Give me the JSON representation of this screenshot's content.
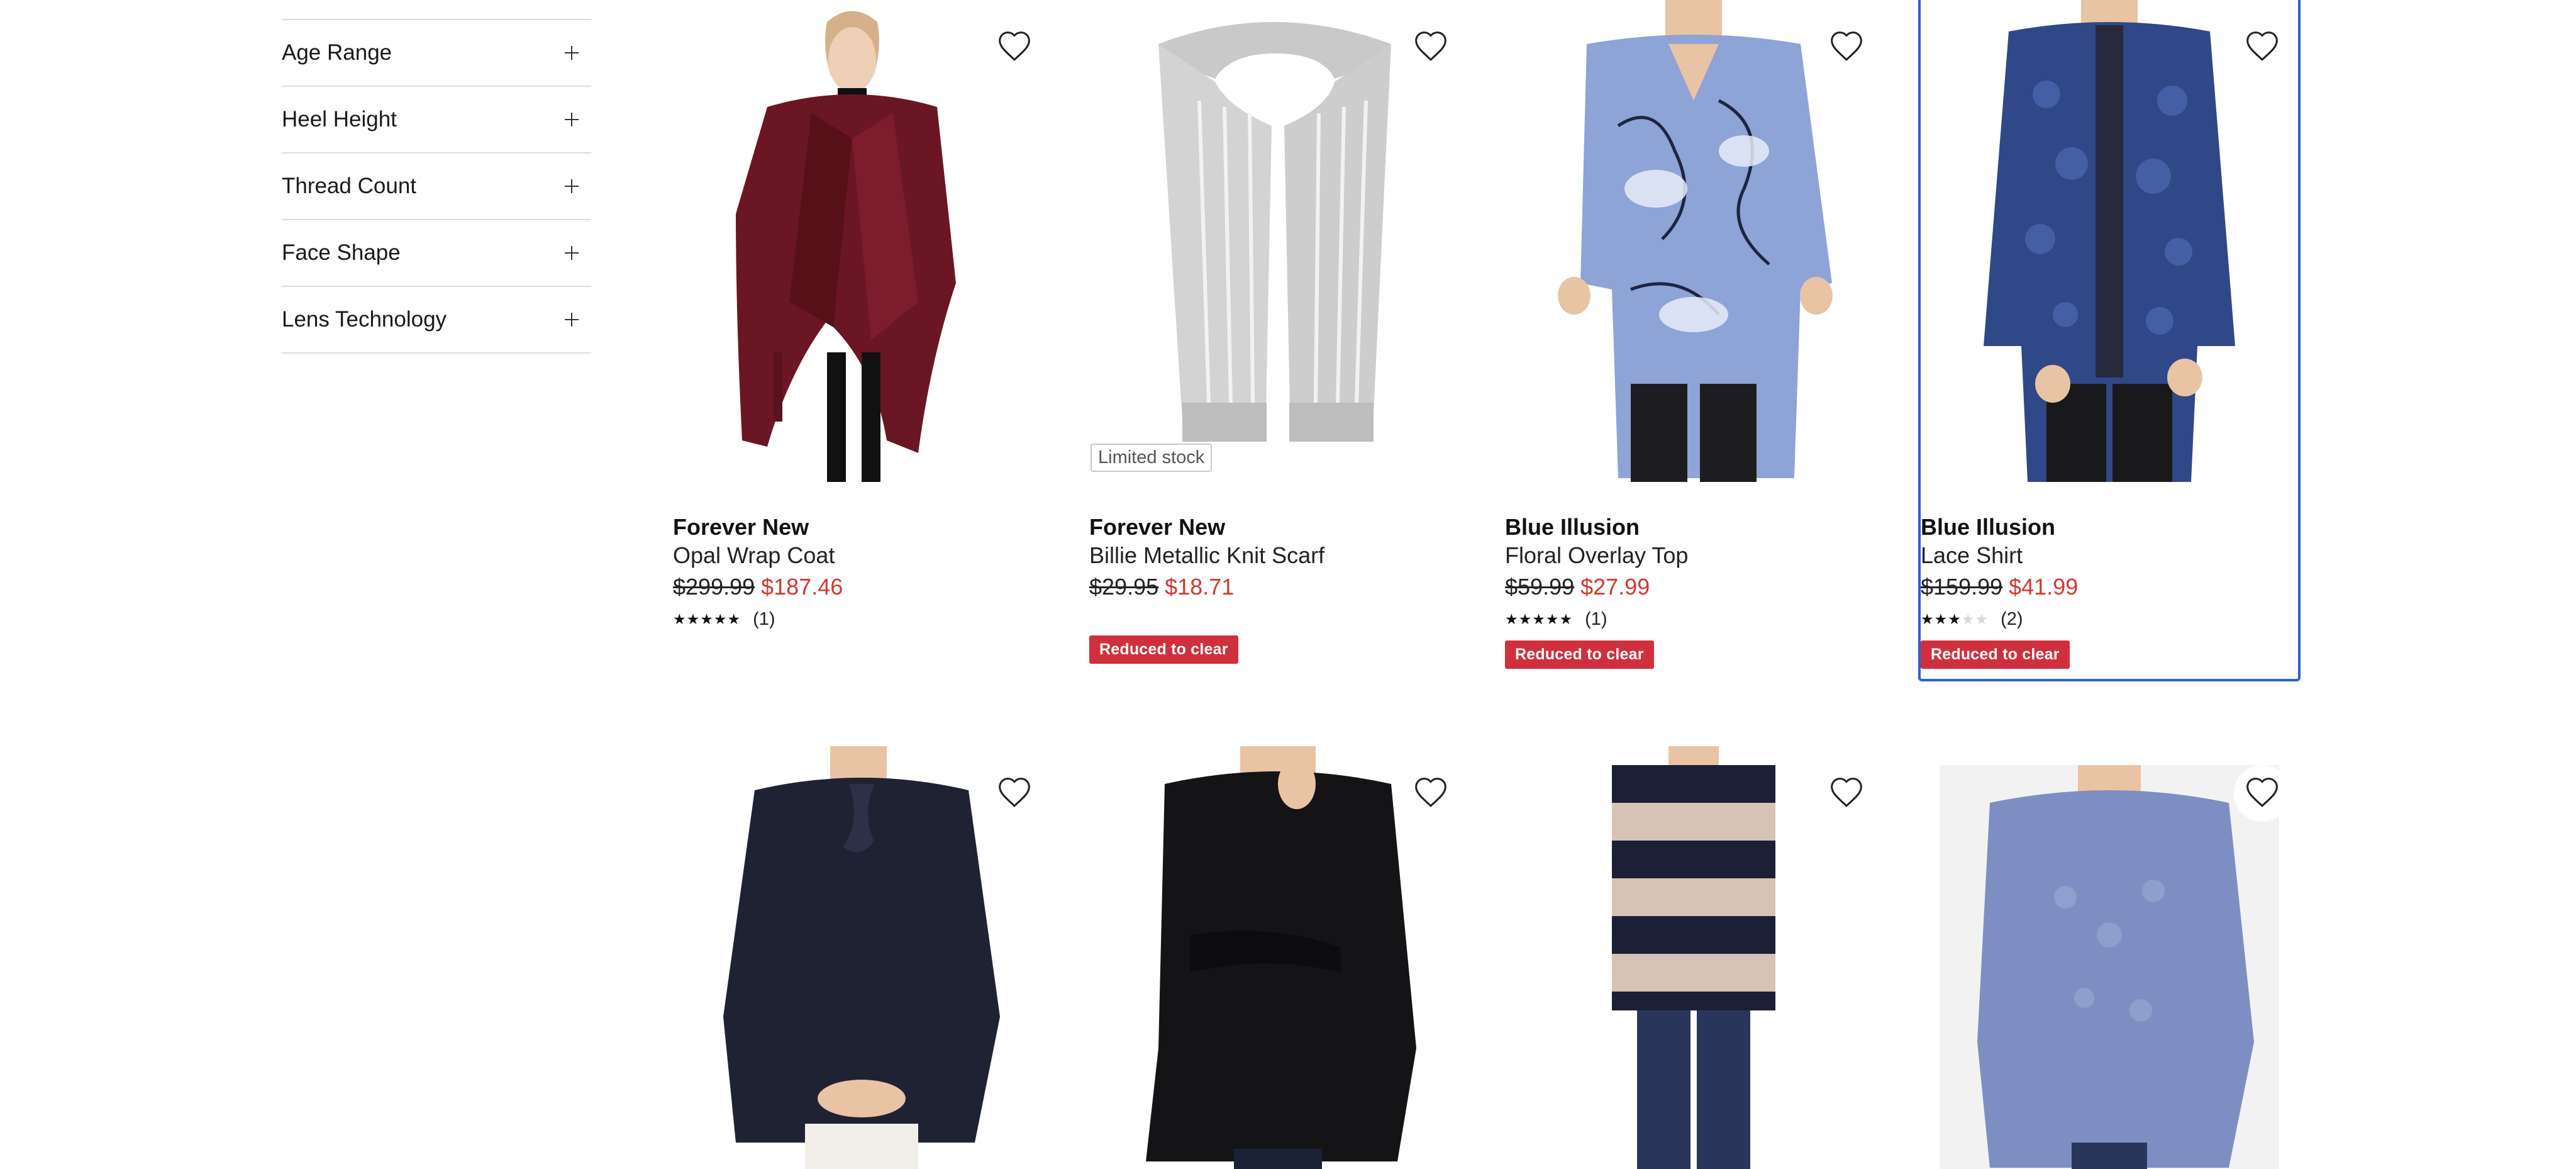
{
  "filters": [
    {
      "label": "Age Range"
    },
    {
      "label": "Heel Height"
    },
    {
      "label": "Thread Count"
    },
    {
      "label": "Face Shape"
    },
    {
      "label": "Lens Technology"
    }
  ],
  "products": [
    {
      "brand": "Forever New",
      "name": "Opal Wrap Coat",
      "old_price": "$299.99",
      "price": "$187.46",
      "rating": 5,
      "rating_count": "(1)",
      "badge": ""
    },
    {
      "brand": "Forever New",
      "name": "Billie Metallic Knit Scarf",
      "old_price": "$29.95",
      "price": "$18.71",
      "tag": "Limited stock",
      "badge": "Reduced to clear"
    },
    {
      "brand": "Blue Illusion",
      "name": "Floral Overlay Top",
      "old_price": "$59.99",
      "price": "$27.99",
      "rating": 5,
      "rating_count": "(1)",
      "badge": "Reduced to clear"
    },
    {
      "brand": "Blue Illusion",
      "name": "Lace Shirt",
      "old_price": "$159.99",
      "price": "$41.99",
      "rating": 3,
      "rating_count": "(2)",
      "badge": "Reduced to clear"
    }
  ],
  "icons": {
    "wishlist": "heart-outline-icon",
    "expand": "plus-icon",
    "rating": "star-icon"
  },
  "colors": {
    "sale_price": "#d4372c",
    "badge_bg": "#d0303c",
    "focus_outline": "#2b5fd9"
  }
}
